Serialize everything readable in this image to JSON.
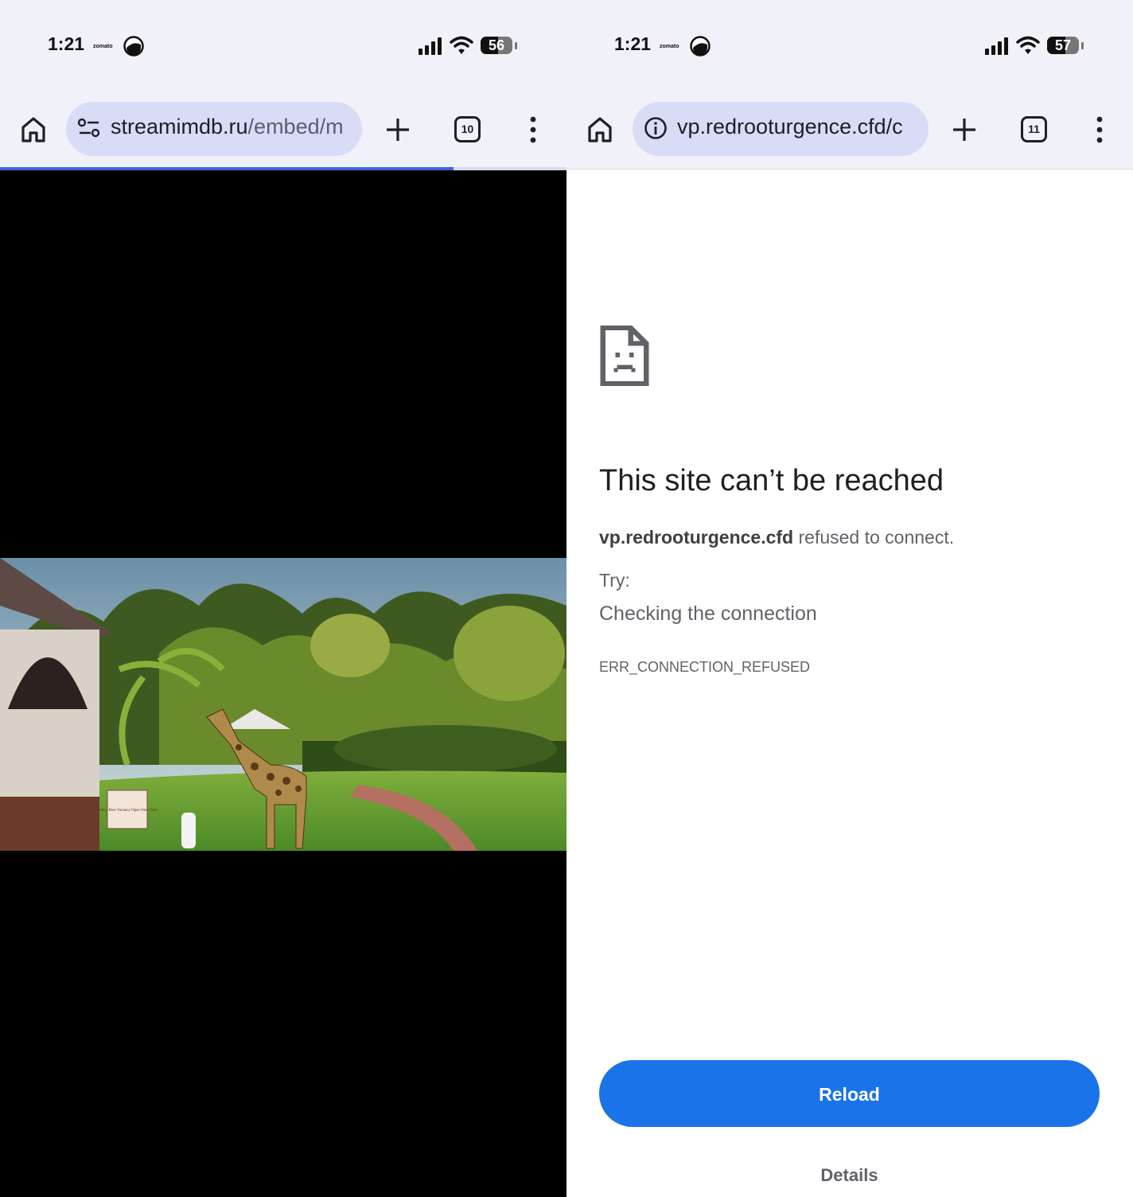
{
  "left": {
    "status": {
      "time": "1:21",
      "app_label": "zomato",
      "battery": "56",
      "battery_level": 0.56
    },
    "toolbar": {
      "url_host": "streamimdb.ru",
      "url_path": "/embed/m",
      "tab_count": "10",
      "load_progress": 0.8
    },
    "video": {
      "sign_text": "Valleys Rest Vacancy Open Now Daily"
    }
  },
  "right": {
    "status": {
      "time": "1:21",
      "app_label": "zomato",
      "battery": "57",
      "battery_level": 0.57
    },
    "toolbar": {
      "url": "vp.redrooturgence.cfd/c",
      "tab_count": "11"
    },
    "error": {
      "title": "This site can’t be reached",
      "host": "vp.redrooturgence.cfd",
      "message": " refused to connect.",
      "try_label": "Try:",
      "suggestion": "Checking the connection",
      "code": "ERR_CONNECTION_REFUSED",
      "reload_label": "Reload",
      "details_label": "Details"
    }
  },
  "icons": [
    "home-icon",
    "site-settings-icon",
    "info-icon",
    "new-tab-icon",
    "tab-switcher-icon",
    "more-menu-icon",
    "signal-icon",
    "wifi-icon",
    "battery-icon",
    "sad-page-icon"
  ],
  "colors": {
    "accent": "#1a73e8",
    "url_pill": "#d9dcf7",
    "toolbar_bg": "#f1f1f9",
    "progress": "#3f63e8"
  }
}
